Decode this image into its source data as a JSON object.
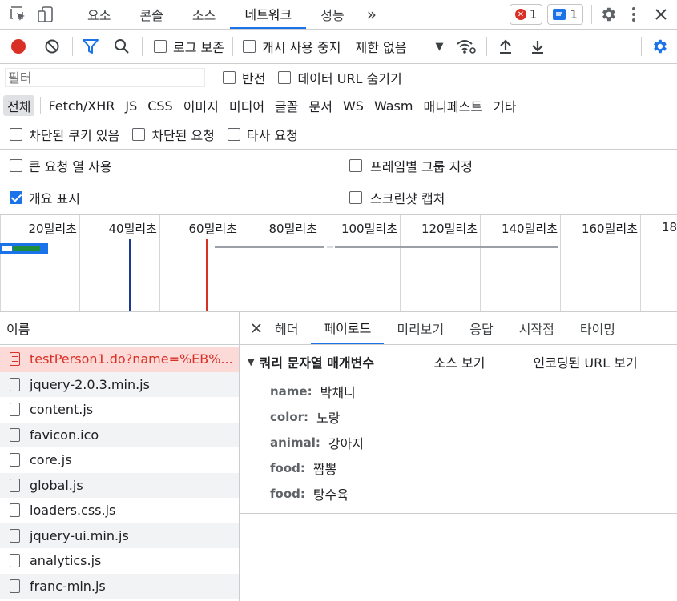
{
  "tabs": [
    "요소",
    "콘솔",
    "소스",
    "네트워크",
    "성능"
  ],
  "more_tabs": "»",
  "errors_count": "1",
  "messages_count": "1",
  "toolbar": {
    "preserve_log": "로그 보존",
    "disable_cache": "캐시 사용 중지",
    "throttling": "제한 없음"
  },
  "filter": {
    "placeholder": "필터",
    "invert": "반전",
    "hide_data_urls": "데이터 URL 숨기기"
  },
  "types": [
    "전체",
    "Fetch/XHR",
    "JS",
    "CSS",
    "이미지",
    "미디어",
    "글꼴",
    "문서",
    "WS",
    "Wasm",
    "매니페스트",
    "기타"
  ],
  "cookie_filters": [
    "차단된 쿠키 있음",
    "차단된 요청",
    "타사 요청"
  ],
  "options": {
    "big_request_rows": "큰 요청 열 사용",
    "group_by_frame": "프레임별 그룹 지정",
    "show_overview": "개요 표시",
    "capture_screenshots": "스크린샷 캡처"
  },
  "timeline_ticks": [
    "20밀리초",
    "40밀리초",
    "60밀리초",
    "80밀리초",
    "100밀리초",
    "120밀리초",
    "140밀리초",
    "160밀리초",
    "18"
  ],
  "list_header": "이름",
  "requests": [
    "testPerson1.do?name=%EB%...",
    "jquery-2.0.3.min.js",
    "content.js",
    "favicon.ico",
    "core.js",
    "global.js",
    "loaders.css.js",
    "jquery-ui.min.js",
    "analytics.js",
    "franc-min.js"
  ],
  "detail_tabs": [
    "헤더",
    "페이로드",
    "미리보기",
    "응답",
    "시작점",
    "타이밍"
  ],
  "payload": {
    "section_title": "쿼리 문자열 매개변수",
    "view_source": "소스 보기",
    "view_url_encoded": "인코딩된 URL 보기",
    "params": [
      {
        "name": "name:",
        "value": "박채니"
      },
      {
        "name": "color:",
        "value": "노랑"
      },
      {
        "name": "animal:",
        "value": "강아지"
      },
      {
        "name": "food:",
        "value": "짬뽕"
      },
      {
        "name": "food:",
        "value": "탕수육"
      }
    ]
  },
  "colors": {
    "accent": "#1a73e8",
    "record": "#d93025",
    "error_row": "#fcdad8"
  }
}
